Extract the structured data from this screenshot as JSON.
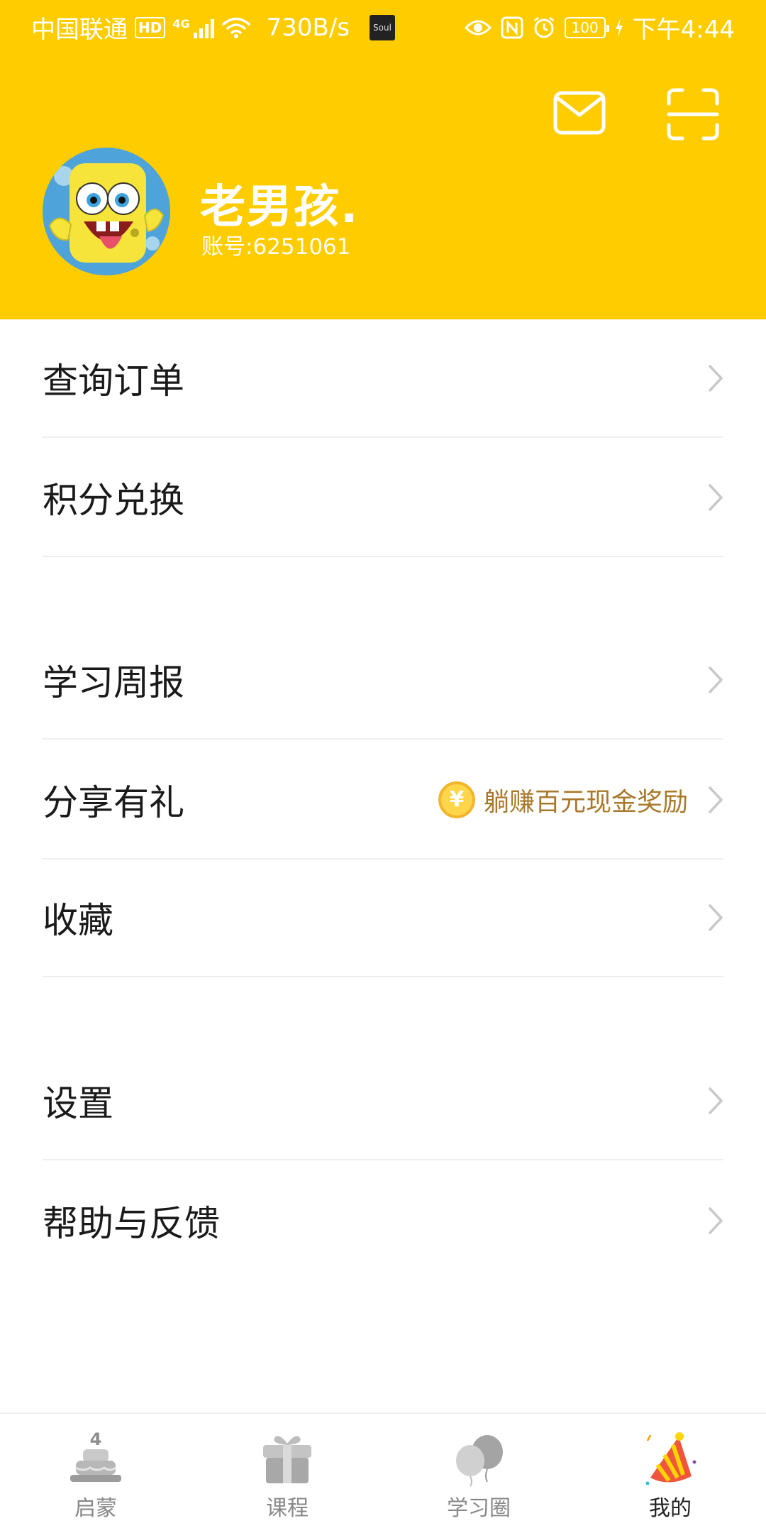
{
  "status_bar": {
    "carrier": "中国联通",
    "hd": "HD",
    "network": "4G",
    "speed": "730B/s",
    "app_badge": "Soul",
    "battery": "100",
    "time": "下午4:44"
  },
  "header": {
    "background_color": "#FFCC00",
    "mail_icon": "mail-icon",
    "scan_icon": "scan-icon",
    "username": "老男孩.",
    "account": "账号:6251061"
  },
  "menu": {
    "orders": "查询订单",
    "points": "积分兑换",
    "weekly_report": "学习周报",
    "share": "分享有礼",
    "share_promo": "躺赚百元现金奖励",
    "share_promo_coin": "¥",
    "favorites": "收藏",
    "settings": "设置",
    "help": "帮助与反馈"
  },
  "tabbar": {
    "tabs": [
      {
        "label": "启蒙",
        "icon": "cake-icon",
        "badge": "4"
      },
      {
        "label": "课程",
        "icon": "gift-icon"
      },
      {
        "label": "学习圈",
        "icon": "balloon-icon"
      },
      {
        "label": "我的",
        "icon": "party-hat-icon",
        "active": true
      }
    ]
  },
  "colors": {
    "accent": "#FFCC00",
    "promo_text": "#A9782A",
    "divider": "#EEEEEE"
  }
}
